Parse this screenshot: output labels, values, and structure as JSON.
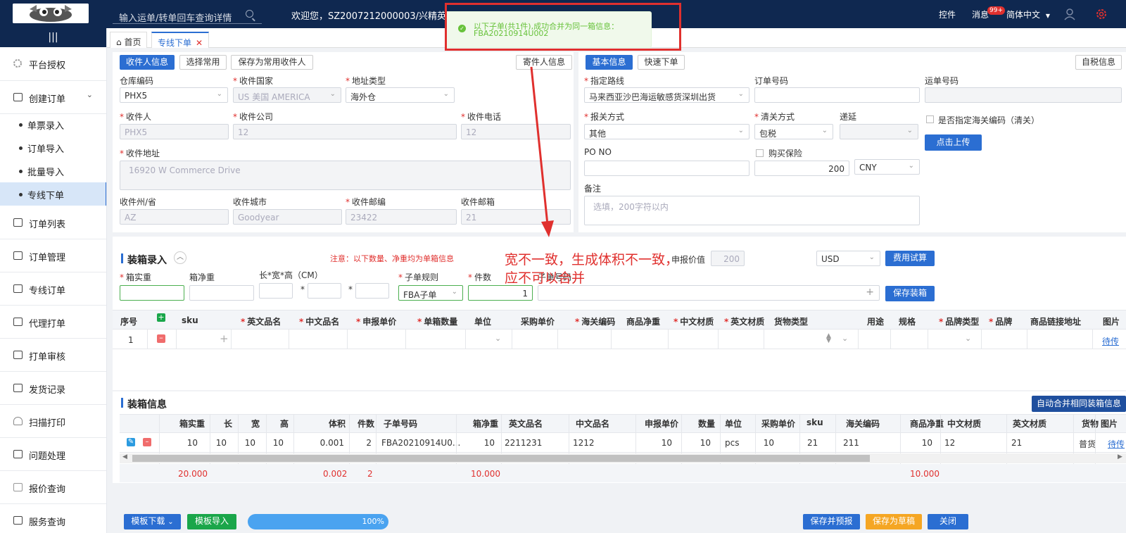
{
  "header": {
    "search_placeholder": "输入运单/转单回车查询详情",
    "welcome": "欢迎您，SZ2007212000003/兴精英子",
    "plugin": "控件",
    "messages": "消息",
    "badge": "99+",
    "language": "简体中文"
  },
  "toast": {
    "line1": "以下子单(共1件),成功合并为同一箱信息：",
    "line2": "FBA20210914U002"
  },
  "sidebar": {
    "collapse": "|||",
    "platform_auth": "平台授权",
    "create_order": "创建订单",
    "single_entry": "单票录入",
    "order_import": "订单导入",
    "batch_import": "批量导入",
    "line_order": "专线下单",
    "order_list": "订单列表",
    "order_mgmt": "订单管理",
    "line_orders": "专线订单",
    "agent_print": "代理打单",
    "print_review": "打单审核",
    "ship_records": "发货记录",
    "scan_print": "扫描打印",
    "issue_handle": "问题处理",
    "quote_query": "报价查询",
    "service_query": "服务查询"
  },
  "tabs": {
    "home": "首页",
    "current": "专线下单"
  },
  "receiver": {
    "tab_info": "收件人信息",
    "tab_select": "选择常用",
    "tab_save": "保存为常用收件人",
    "sender_btn": "寄件人信息",
    "warehouse_label": "仓库编码",
    "warehouse_value": "PHX5",
    "country_label": "收件国家",
    "country_value": "US 美国 AMERICA",
    "addr_type_label": "地址类型",
    "addr_type_value": "海外仓",
    "name_label": "收件人",
    "name_value": "PHX5",
    "company_label": "收件公司",
    "company_value": "12",
    "phone_label": "收件电话",
    "phone_value": "12",
    "address_label": "收件地址",
    "address_value": "16920 W Commerce Drive",
    "state_label": "收件州/省",
    "state_value": "AZ",
    "city_label": "收件城市",
    "city_value": "Goodyear",
    "zip_label": "收件邮编",
    "zip_value": "23422",
    "email_label": "收件邮箱",
    "email_value": "21"
  },
  "basic": {
    "tab_basic": "基本信息",
    "tab_quick": "快速下单",
    "tax_btn": "自税信息",
    "route_label": "指定路线",
    "route_value": "马来西亚沙巴海运敏感货深圳出货",
    "order_no_label": "订单号码",
    "waybill_label": "运单号码",
    "declare_label": "报关方式",
    "declare_value": "其他",
    "clear_label": "清关方式",
    "clear_value": "包税",
    "deferred_label": "递延",
    "customs_code_label": "是否指定海关编码（清关）",
    "upload_btn": "点击上传",
    "po_label": "PO NO",
    "insurance_label": "购买保险",
    "insurance_value": "200",
    "currency_value": "CNY",
    "remark_label": "备注",
    "remark_placeholder": "选填，200字符以内"
  },
  "packing": {
    "title": "装箱录入",
    "note": "注意：以下数量、净重均为单箱信息",
    "annotation_line1": "宽不一致，生成体积不一致，",
    "annotation_line2": "应不可以合并",
    "declare_value_label": "申报价值",
    "declare_value": "200",
    "currency": "USD",
    "calc_btn": "费用试算",
    "weight_label": "箱实重",
    "net_label": "箱净重",
    "dims_label": "长*宽*高（CM）",
    "star": "*",
    "rule_label": "子单规则",
    "rule_value": "FBA子单",
    "count_label": "件数",
    "count_value": "1",
    "sub_no_label": "子单号码",
    "save_btn": "保存装箱",
    "plus": "+",
    "table_headers": [
      "序号",
      "sku",
      "英文品名",
      "中文品名",
      "申报单价",
      "单箱数量",
      "单位",
      "采购单价",
      "海关编码",
      "商品净重",
      "中文材质",
      "英文材质",
      "货物类型",
      "用途",
      "规格",
      "品牌类型",
      "品牌",
      "商品链接地址",
      "图片"
    ],
    "row_index": "1",
    "row_link": "待传"
  },
  "box_info": {
    "title": "装箱信息",
    "merge_btn": "自动合并相同装箱信息",
    "headers": [
      "箱实重",
      "长",
      "宽",
      "高",
      "体积",
      "件数",
      "子单号码",
      "箱净重",
      "英文品名",
      "中文品名",
      "申报单价",
      "数量",
      "单位",
      "采购单价",
      "sku",
      "海关编码",
      "商品净重",
      "中文材质",
      "英文材质",
      "货物",
      "图片"
    ],
    "row": [
      "10",
      "10",
      "10",
      "10",
      "0.001",
      "2",
      "FBA20210914U0...",
      "10",
      "2211231",
      "1212",
      "10",
      "10",
      "pcs",
      "10",
      "21",
      "211",
      "10",
      "12",
      "21",
      "普货"
    ],
    "row_link": "待传",
    "totals": {
      "weight": "20.000",
      "volume": "0.002",
      "count": "2",
      "net": "10.000",
      "goods_net": "10.000"
    }
  },
  "footer": {
    "template_download": "模板下载",
    "template_import": "模板导入",
    "progress": "100%",
    "progress_fraction": 1.0,
    "save_forecast": "保存并预报",
    "save_draft": "保存为草稿",
    "close": "关闭"
  }
}
